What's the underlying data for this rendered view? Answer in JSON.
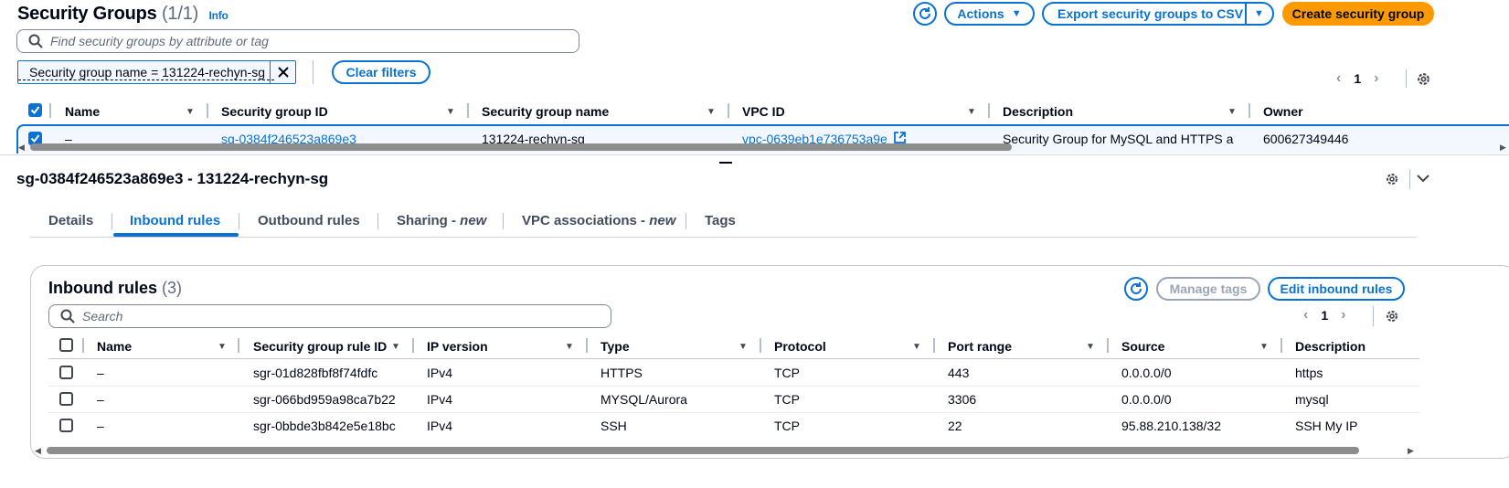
{
  "header": {
    "title": "Security Groups",
    "count": "(1/1)",
    "info": "Info",
    "actions_label": "Actions",
    "export_label": "Export security groups to CSV",
    "create_label": "Create security group"
  },
  "filter": {
    "placeholder": "Find security groups by attribute or tag",
    "token": "Security group name = 131224-rechyn-sg",
    "clear_label": "Clear filters"
  },
  "pagination": {
    "page": "1"
  },
  "groups_table": {
    "columns": [
      "Name",
      "Security group ID",
      "Security group name",
      "VPC ID",
      "Description",
      "Owner"
    ],
    "row": {
      "name": "–",
      "id": "sg-0384f246523a869e3",
      "group_name": "131224-rechyn-sg",
      "vpc_id": "vpc-0639eb1e736753a9e",
      "description": "Security Group for MySQL and HTTPS a",
      "owner": "600627349446"
    }
  },
  "detail": {
    "title": "sg-0384f246523a869e3 - 131224-rechyn-sg",
    "tabs": [
      {
        "label": "Details"
      },
      {
        "label": "Inbound rules"
      },
      {
        "label": "Outbound rules"
      },
      {
        "label": "Sharing - ",
        "suffix": "new"
      },
      {
        "label": "VPC associations - ",
        "suffix": "new"
      },
      {
        "label": "Tags"
      }
    ]
  },
  "inbound": {
    "title": "Inbound rules",
    "count": "(3)",
    "manage_tags_label": "Manage tags",
    "edit_label": "Edit inbound rules",
    "search_placeholder": "Search",
    "page": "1",
    "columns": [
      "Name",
      "Security group rule ID",
      "IP version",
      "Type",
      "Protocol",
      "Port range",
      "Source",
      "Description"
    ],
    "rows": [
      {
        "name": "–",
        "rule_id": "sgr-01d828fbf8f74fdfc",
        "ip": "IPv4",
        "type": "HTTPS",
        "protocol": "TCP",
        "port": "443",
        "source": "0.0.0.0/0",
        "description": "https"
      },
      {
        "name": "–",
        "rule_id": "sgr-066bd959a98ca7b22",
        "ip": "IPv4",
        "type": "MYSQL/Aurora",
        "protocol": "TCP",
        "port": "3306",
        "source": "0.0.0.0/0",
        "description": "mysql"
      },
      {
        "name": "–",
        "rule_id": "sgr-0bbde3b842e5e18bc",
        "ip": "IPv4",
        "type": "SSH",
        "protocol": "TCP",
        "port": "22",
        "source": "95.88.210.138/32",
        "description": "SSH My IP"
      }
    ]
  },
  "colors": {
    "accent": "#0972d3",
    "primary": "#ff9900",
    "text": "#000716"
  }
}
